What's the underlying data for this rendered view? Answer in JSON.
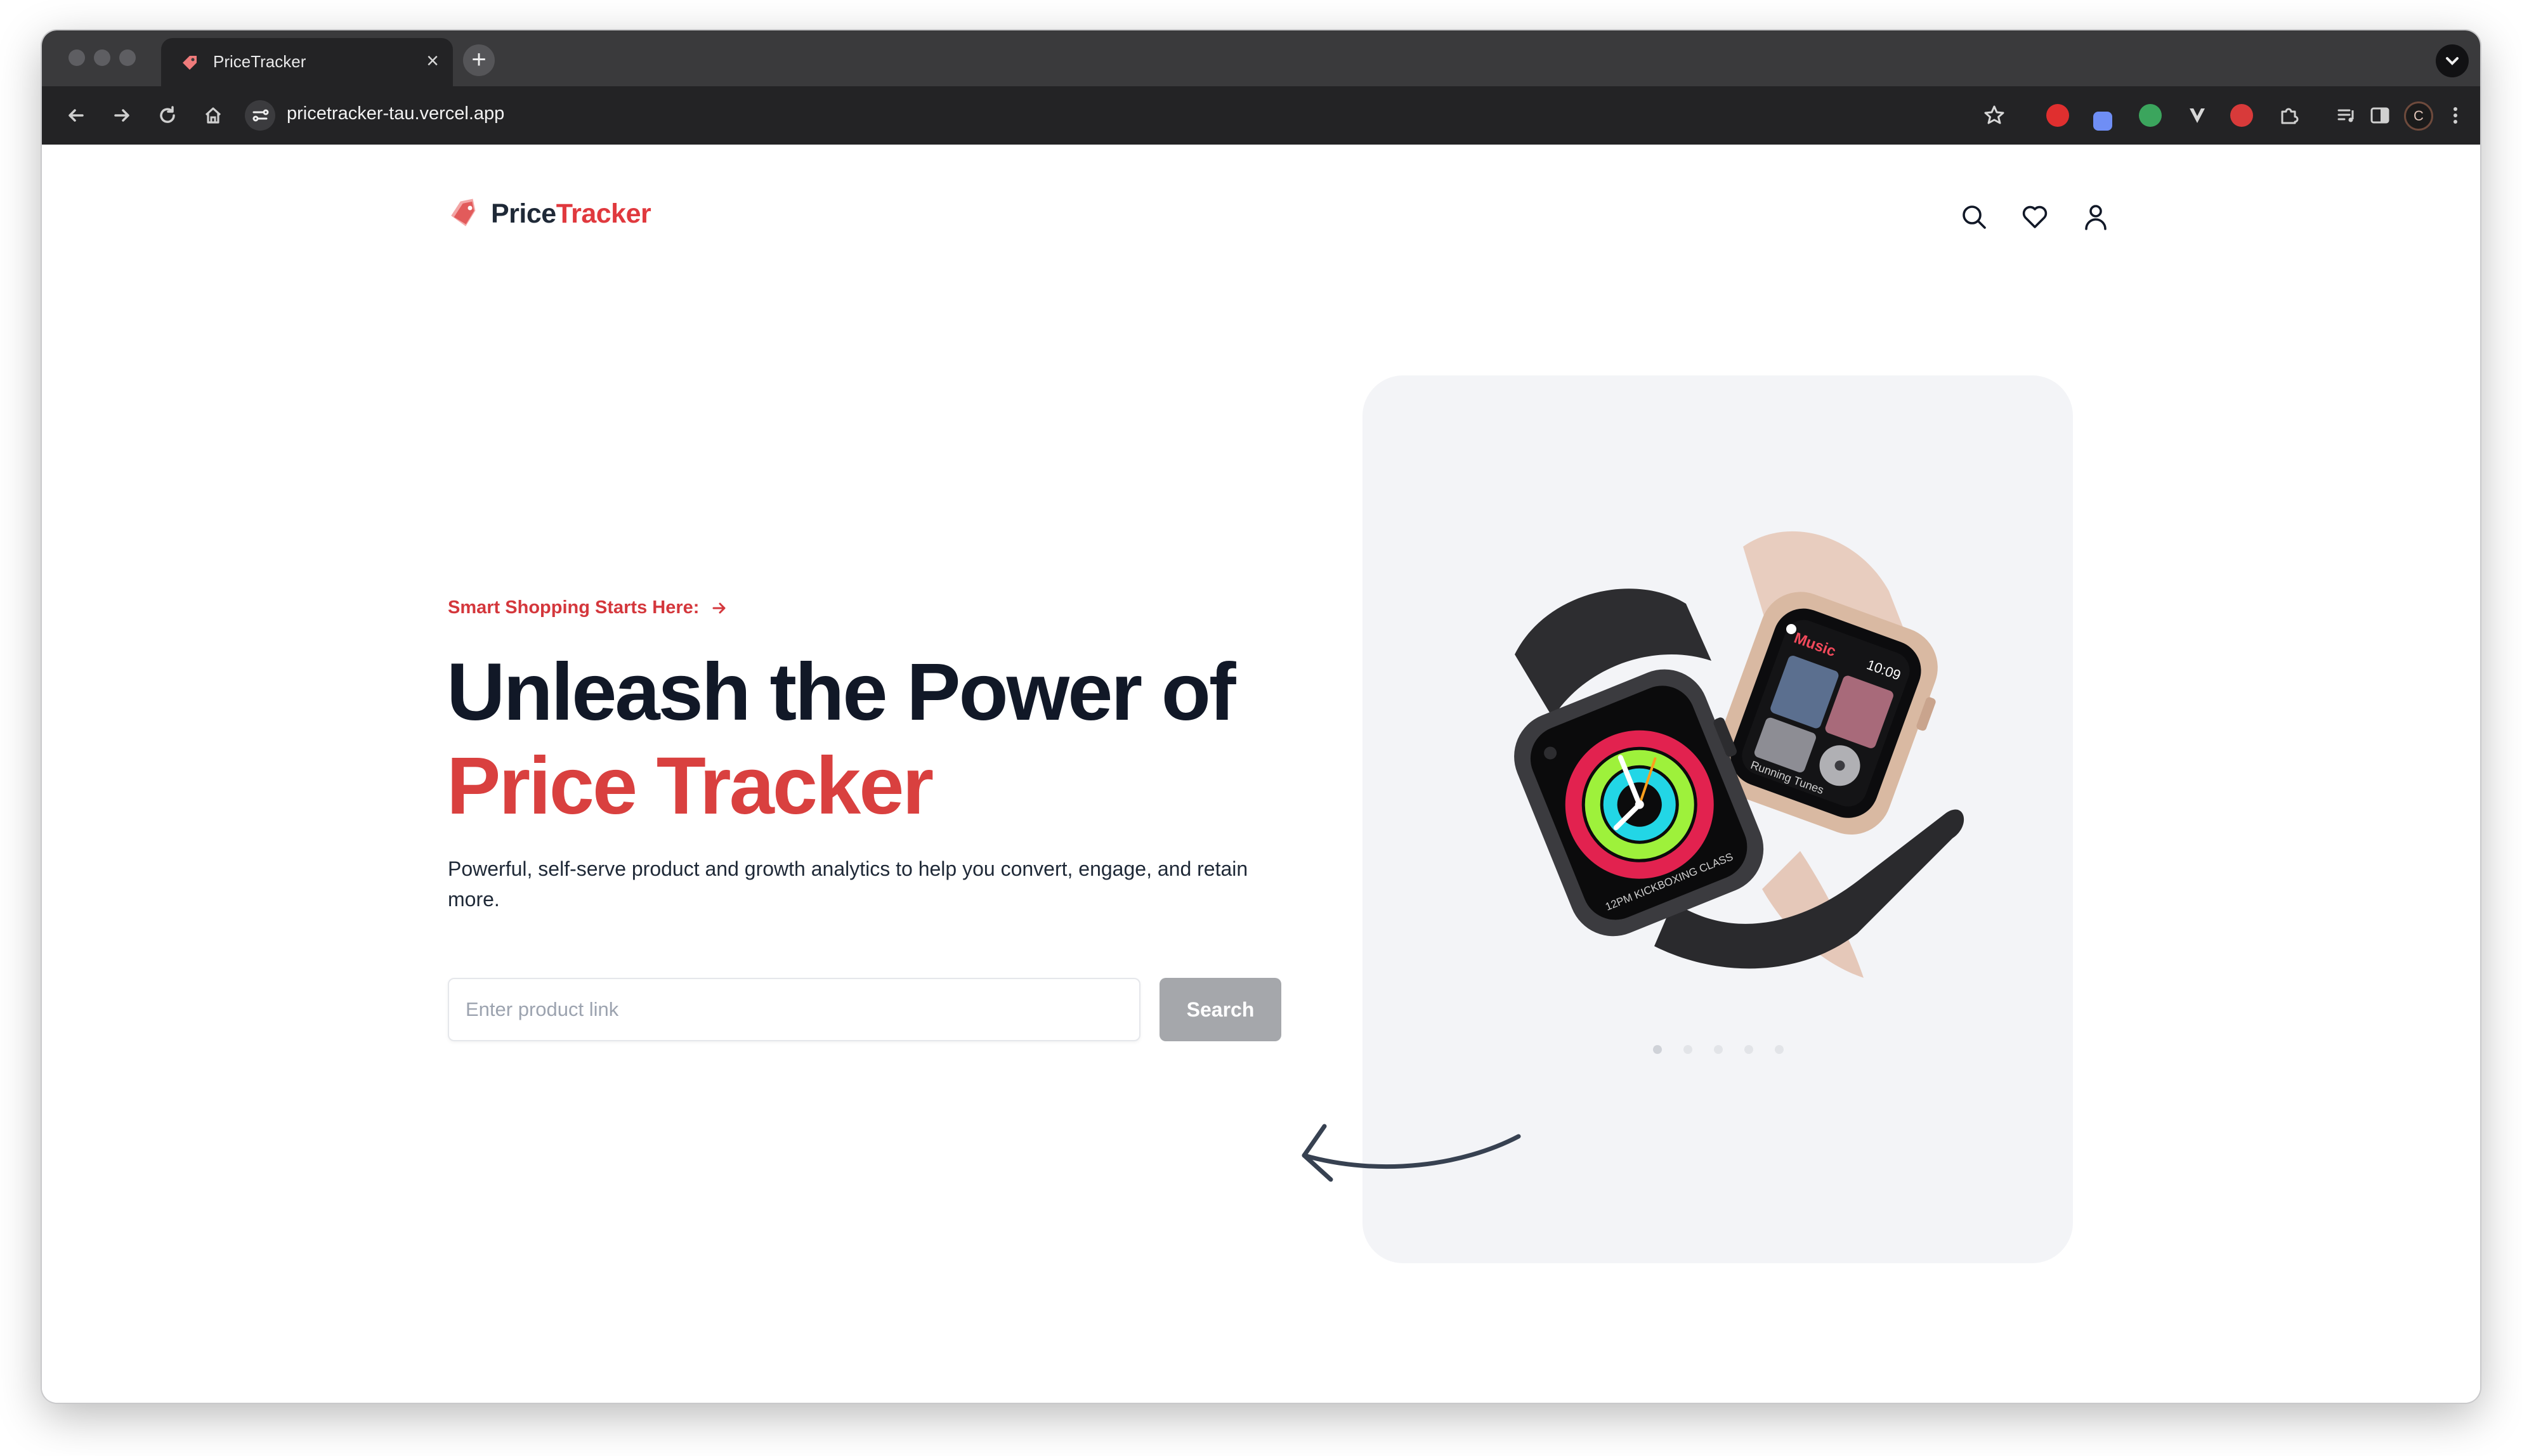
{
  "browser": {
    "tab": {
      "title": "PriceTracker",
      "close_glyph": "×"
    },
    "new_tab_glyph": "+",
    "address": {
      "url": "pricetracker-tau.vercel.app"
    },
    "profile_initial": "C"
  },
  "header": {
    "logo": {
      "word1": "Price",
      "word2": "Tracker"
    }
  },
  "hero": {
    "eyebrow": "Smart Shopping Starts Here:",
    "headline_line1": "Unleash the Power of",
    "headline_line2": "Price Tracker",
    "subtext": "Powerful, self-serve product and growth analytics to help you convert, engage, and retain more.",
    "search": {
      "placeholder": "Enter product link",
      "value": "",
      "button_label": "Search"
    },
    "carousel": {
      "slide_count": 5,
      "active_index": 0
    },
    "watch_face": {
      "time": "10:09",
      "app": "Music",
      "track": "Running Tunes",
      "workout": "12PM KICKBOXING CLASS"
    }
  },
  "colors": {
    "accent": "#d9403f",
    "heading": "#111827",
    "button_disabled": "#a5a7ab",
    "card_bg": "#f3f4f7"
  }
}
